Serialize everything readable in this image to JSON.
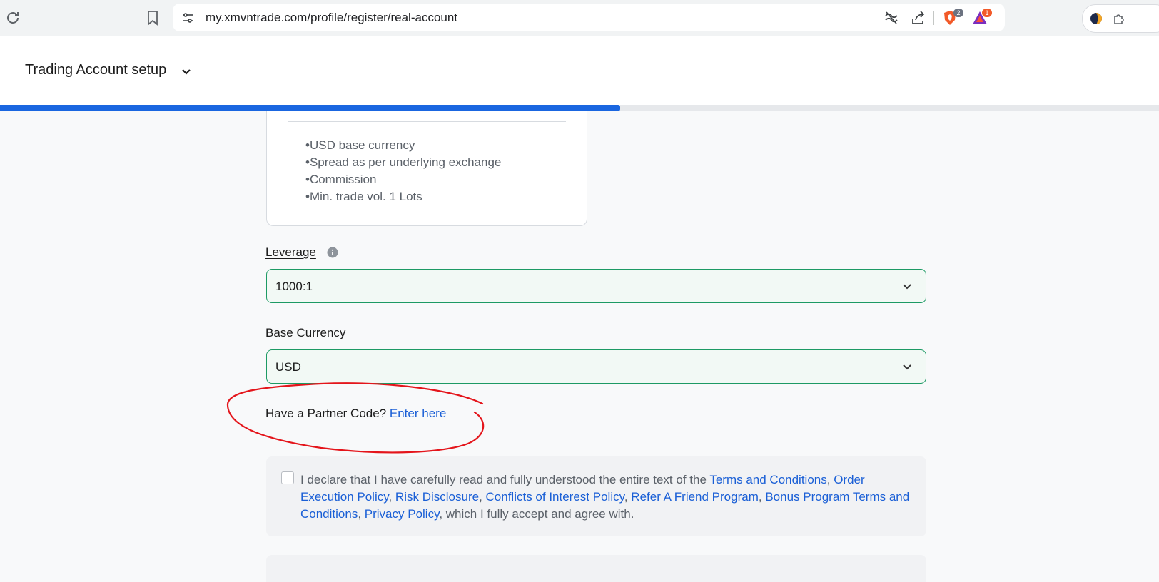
{
  "browser": {
    "url": "my.xmvntrade.com/profile/register/real-account",
    "badges": {
      "brave": "2",
      "rewards": "1"
    }
  },
  "header": {
    "title": "Trading Account setup",
    "progress_percent": 53.5
  },
  "account_card": {
    "features": [
      "•USD base currency",
      "•Spread as per underlying exchange",
      "•Commission",
      "•Min. trade vol. 1 Lots"
    ]
  },
  "form": {
    "leverage": {
      "label": "Leverage",
      "value": "1000:1"
    },
    "base_currency": {
      "label": "Base Currency",
      "value": "USD"
    },
    "partner": {
      "prompt": "Have a Partner Code?",
      "link": "Enter here"
    },
    "declaration": {
      "intro": "I declare that I have carefully read and fully understood the entire text of the",
      "links": [
        "Terms and Conditions",
        "Order Execution Policy",
        "Risk Disclosure",
        "Conflicts of Interest Policy",
        "Refer A Friend Program",
        "Bonus Program Terms and Conditions",
        "Privacy Policy"
      ],
      "sep": ", ",
      "outro": ", which I fully accept and agree with."
    }
  },
  "colors": {
    "accent_blue": "#1a66e0",
    "select_border": "#1d9a64",
    "annotation_red": "#e4151b"
  }
}
